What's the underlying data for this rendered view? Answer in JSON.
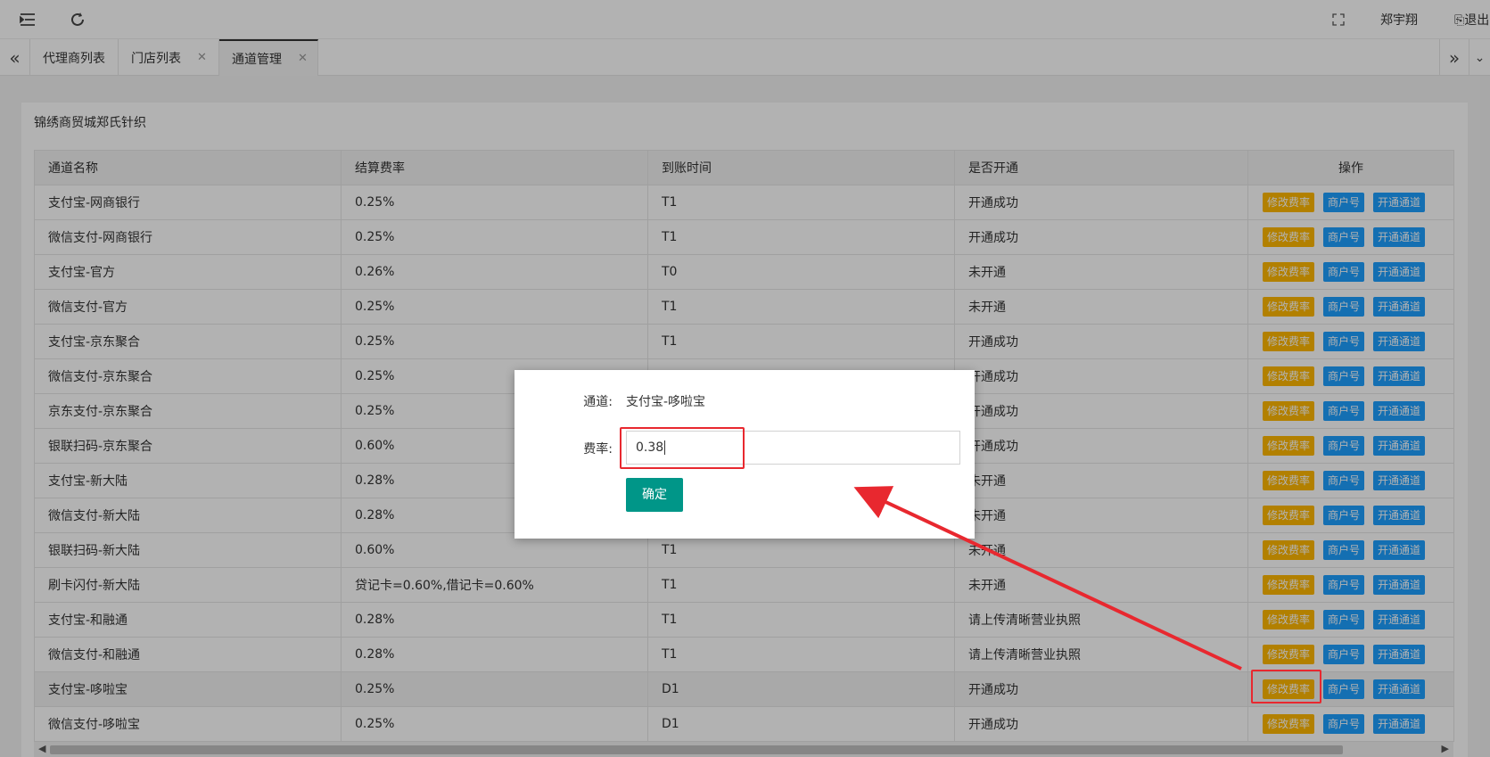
{
  "header": {
    "user_name": "郑宇翔",
    "logout_label": "退出"
  },
  "tabs": [
    {
      "label": "代理商列表",
      "closable": false
    },
    {
      "label": "门店列表",
      "closable": true
    },
    {
      "label": "通道管理",
      "closable": true,
      "active": true
    }
  ],
  "panel": {
    "title": "锦绣商贸城郑氏针织"
  },
  "table": {
    "columns": [
      "通道名称",
      "结算费率",
      "到账时间",
      "是否开通",
      "操作"
    ],
    "action_labels": {
      "edit_rate": "修改费率",
      "merchant_no": "商户号",
      "open_channel": "开通通道"
    },
    "rows": [
      {
        "name": "支付宝-网商银行",
        "rate": "0.25%",
        "time": "T1",
        "status": "开通成功"
      },
      {
        "name": "微信支付-网商银行",
        "rate": "0.25%",
        "time": "T1",
        "status": "开通成功"
      },
      {
        "name": "支付宝-官方",
        "rate": "0.26%",
        "time": "T0",
        "status": "未开通"
      },
      {
        "name": "微信支付-官方",
        "rate": "0.25%",
        "time": "T1",
        "status": "未开通"
      },
      {
        "name": "支付宝-京东聚合",
        "rate": "0.25%",
        "time": "T1",
        "status": "开通成功"
      },
      {
        "name": "微信支付-京东聚合",
        "rate": "0.25%",
        "time": "",
        "status": "开通成功"
      },
      {
        "name": "京东支付-京东聚合",
        "rate": "0.25%",
        "time": "",
        "status": "开通成功"
      },
      {
        "name": "银联扫码-京东聚合",
        "rate": "0.60%",
        "time": "",
        "status": "开通成功"
      },
      {
        "name": "支付宝-新大陆",
        "rate": "0.28%",
        "time": "",
        "status": "未开通"
      },
      {
        "name": "微信支付-新大陆",
        "rate": "0.28%",
        "time": "",
        "status": "未开通"
      },
      {
        "name": "银联扫码-新大陆",
        "rate": "0.60%",
        "time": "T1",
        "status": "未开通"
      },
      {
        "name": "刷卡闪付-新大陆",
        "rate": "贷记卡=0.60%,借记卡=0.60%",
        "time": "T1",
        "status": "未开通"
      },
      {
        "name": "支付宝-和融通",
        "rate": "0.28%",
        "time": "T1",
        "status": "请上传清晰营业执照"
      },
      {
        "name": "微信支付-和融通",
        "rate": "0.28%",
        "time": "T1",
        "status": "请上传清晰营业执照"
      },
      {
        "name": "支付宝-哆啦宝",
        "rate": "0.25%",
        "time": "D1",
        "status": "开通成功",
        "highlight": true
      },
      {
        "name": "微信支付-哆啦宝",
        "rate": "0.25%",
        "time": "D1",
        "status": "开通成功"
      }
    ]
  },
  "modal": {
    "channel_label": "通道:",
    "channel_value": "支付宝-哆啦宝",
    "rate_label": "费率:",
    "rate_value": "0.38",
    "confirm_label": "确定"
  },
  "colors": {
    "orange_button": "#FFB800",
    "blue_button": "#1E9FFF",
    "confirm_button": "#009688",
    "annotation_red": "#e8282f"
  }
}
